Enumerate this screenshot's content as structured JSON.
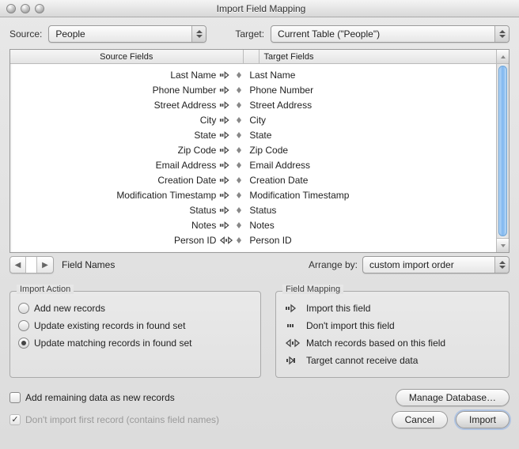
{
  "window": {
    "title": "Import Field Mapping"
  },
  "top": {
    "source_label": "Source:",
    "source_value": "People",
    "target_label": "Target:",
    "target_value": "Current Table (\"People\")"
  },
  "columns": {
    "source": "Source Fields",
    "target": "Target Fields"
  },
  "mappings": [
    {
      "src": "Last Name",
      "mode": "import",
      "tgt": "Last Name"
    },
    {
      "src": "Phone Number",
      "mode": "import",
      "tgt": "Phone Number"
    },
    {
      "src": "Street Address",
      "mode": "import",
      "tgt": "Street Address"
    },
    {
      "src": "City",
      "mode": "import",
      "tgt": "City"
    },
    {
      "src": "State",
      "mode": "import",
      "tgt": "State"
    },
    {
      "src": "Zip Code",
      "mode": "import",
      "tgt": "Zip Code"
    },
    {
      "src": "Email Address",
      "mode": "import",
      "tgt": "Email Address"
    },
    {
      "src": "Creation Date",
      "mode": "import",
      "tgt": "Creation Date"
    },
    {
      "src": "Modification Timestamp",
      "mode": "import",
      "tgt": "Modification Timestamp"
    },
    {
      "src": "Status",
      "mode": "import",
      "tgt": "Status"
    },
    {
      "src": "Notes",
      "mode": "import",
      "tgt": "Notes"
    },
    {
      "src": "Person ID",
      "mode": "match",
      "tgt": "Person ID"
    }
  ],
  "under_list": {
    "field_names": "Field Names",
    "arrange_label": "Arrange by:",
    "arrange_value": "custom import order"
  },
  "import_action": {
    "title": "Import Action",
    "options": [
      {
        "label": "Add new records",
        "checked": false
      },
      {
        "label": "Update existing records in found set",
        "checked": false
      },
      {
        "label": "Update matching records in found set",
        "checked": true
      }
    ]
  },
  "field_mapping_legend": {
    "title": "Field Mapping",
    "items": [
      {
        "sym": "import",
        "label": "Import this field"
      },
      {
        "sym": "noimport",
        "label": "Don't import this field"
      },
      {
        "sym": "match",
        "label": "Match records based on this field"
      },
      {
        "sym": "nowrite",
        "label": "Target cannot receive data"
      }
    ]
  },
  "bottom": {
    "add_remaining": {
      "label": "Add remaining data as new records",
      "checked": false
    },
    "dont_import_first": {
      "label": "Don't import first record (contains field names)",
      "checked": true,
      "disabled": true
    },
    "manage_db": "Manage Database…",
    "cancel": "Cancel",
    "import": "Import"
  }
}
